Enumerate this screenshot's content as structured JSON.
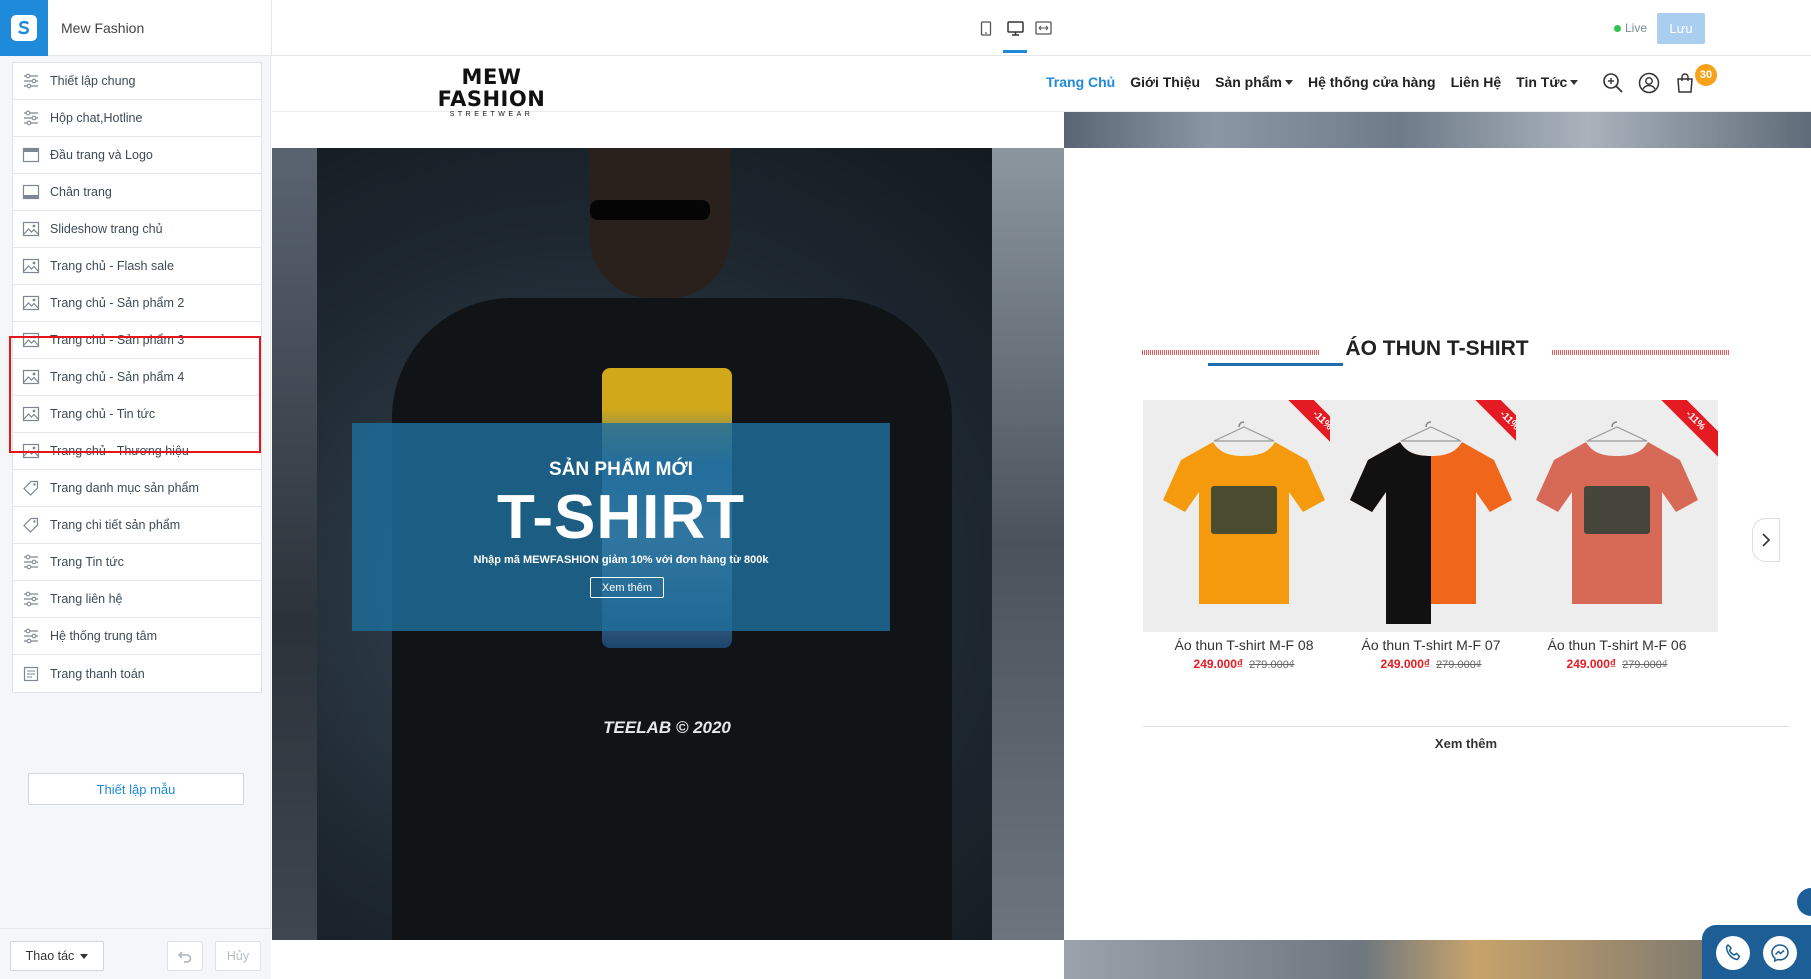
{
  "topbar": {
    "store_name": "Mew Fashion",
    "live_label": "Live",
    "save_label": "Lưu"
  },
  "sidebar": {
    "items": [
      {
        "label": "Thiết lập chung",
        "icon": "settings-sliders-icon"
      },
      {
        "label": "Hộp chat,Hotline",
        "icon": "settings-sliders-icon"
      },
      {
        "label": "Đầu trang và Logo",
        "icon": "header-layout-icon"
      },
      {
        "label": "Chân trang",
        "icon": "footer-layout-icon"
      },
      {
        "label": "Slideshow trang chủ",
        "icon": "image-icon"
      },
      {
        "label": "Trang chủ - Flash sale",
        "icon": "image-icon"
      },
      {
        "label": "Trang chủ - Sản phẩm 2",
        "icon": "image-icon"
      },
      {
        "label": "Trang chủ - Sản phẩm 3",
        "icon": "image-icon"
      },
      {
        "label": "Trang chủ - Sản phẩm 4",
        "icon": "image-icon"
      },
      {
        "label": "Trang chủ - Tin tức",
        "icon": "image-icon"
      },
      {
        "label": "Trang chủ - Thương hiệu",
        "icon": "image-icon"
      },
      {
        "label": "Trang danh mục sản phẩm",
        "icon": "tag-icon"
      },
      {
        "label": "Trang chi tiết sản phẩm",
        "icon": "tag-icon"
      },
      {
        "label": "Trang Tin tức",
        "icon": "settings-sliders-icon"
      },
      {
        "label": "Trang liên hệ",
        "icon": "settings-sliders-icon"
      },
      {
        "label": "Hệ thống trung tâm",
        "icon": "settings-sliders-icon"
      },
      {
        "label": "Trang thanh toán",
        "icon": "cart-page-icon"
      }
    ],
    "template_button": "Thiết lập mẫu",
    "action_button": "Thao tác",
    "cancel_button": "Hủy"
  },
  "site": {
    "brand_main": "MEW FASHION",
    "brand_sub": "STREETWEAR",
    "nav": [
      {
        "label": "Trang Chủ",
        "active": true,
        "dropdown": false
      },
      {
        "label": "Giới Thiệu",
        "active": false,
        "dropdown": false
      },
      {
        "label": "Sản phẩm",
        "active": false,
        "dropdown": true
      },
      {
        "label": "Hệ thống cửa hàng",
        "active": false,
        "dropdown": false
      },
      {
        "label": "Liên Hệ",
        "active": false,
        "dropdown": false
      },
      {
        "label": "Tin Tức",
        "active": false,
        "dropdown": true
      }
    ],
    "cart_count": "30"
  },
  "hero": {
    "subtitle": "SẢN PHẨM MỚI",
    "title": "T-SHIRT",
    "description": "Nhập mã MEWFASHION giảm 10% với đơn hàng từ 800k",
    "button": "Xem thêm",
    "print_text": "TEELAB © 2020"
  },
  "products_section": {
    "title": "ÁO THUN T-SHIRT",
    "see_more": "Xem thêm",
    "products": [
      {
        "name": "Áo thun T-shirt M-F 08",
        "price": "249.000₫",
        "old_price": "279.000₫",
        "discount": "-11%",
        "shirt_color": "#f59a0c"
      },
      {
        "name": "Áo thun T-shirt M-F 07",
        "price": "249.000₫",
        "old_price": "279.000₫",
        "discount": "-11%",
        "shirt_color": "#f0661b"
      },
      {
        "name": "Áo thun T-shirt M-F 06",
        "price": "249.000₫",
        "old_price": "279.000₫",
        "discount": "-11%",
        "shirt_color": "#d66a56"
      }
    ]
  },
  "colors": {
    "accent": "#1f8ad9",
    "sale_red": "#e41b23",
    "highlight_border": "#e4161c"
  }
}
